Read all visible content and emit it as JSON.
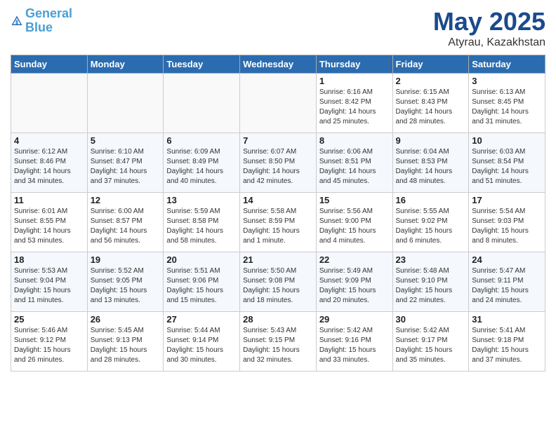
{
  "header": {
    "logo_line1": "General",
    "logo_line2": "Blue",
    "title": "May 2025",
    "location": "Atyrau, Kazakhstan"
  },
  "weekdays": [
    "Sunday",
    "Monday",
    "Tuesday",
    "Wednesday",
    "Thursday",
    "Friday",
    "Saturday"
  ],
  "weeks": [
    [
      {
        "day": "",
        "info": "",
        "empty": true
      },
      {
        "day": "",
        "info": "",
        "empty": true
      },
      {
        "day": "",
        "info": "",
        "empty": true
      },
      {
        "day": "",
        "info": "",
        "empty": true
      },
      {
        "day": "1",
        "info": "Sunrise: 6:16 AM\nSunset: 8:42 PM\nDaylight: 14 hours\nand 25 minutes."
      },
      {
        "day": "2",
        "info": "Sunrise: 6:15 AM\nSunset: 8:43 PM\nDaylight: 14 hours\nand 28 minutes."
      },
      {
        "day": "3",
        "info": "Sunrise: 6:13 AM\nSunset: 8:45 PM\nDaylight: 14 hours\nand 31 minutes."
      }
    ],
    [
      {
        "day": "4",
        "info": "Sunrise: 6:12 AM\nSunset: 8:46 PM\nDaylight: 14 hours\nand 34 minutes."
      },
      {
        "day": "5",
        "info": "Sunrise: 6:10 AM\nSunset: 8:47 PM\nDaylight: 14 hours\nand 37 minutes."
      },
      {
        "day": "6",
        "info": "Sunrise: 6:09 AM\nSunset: 8:49 PM\nDaylight: 14 hours\nand 40 minutes."
      },
      {
        "day": "7",
        "info": "Sunrise: 6:07 AM\nSunset: 8:50 PM\nDaylight: 14 hours\nand 42 minutes."
      },
      {
        "day": "8",
        "info": "Sunrise: 6:06 AM\nSunset: 8:51 PM\nDaylight: 14 hours\nand 45 minutes."
      },
      {
        "day": "9",
        "info": "Sunrise: 6:04 AM\nSunset: 8:53 PM\nDaylight: 14 hours\nand 48 minutes."
      },
      {
        "day": "10",
        "info": "Sunrise: 6:03 AM\nSunset: 8:54 PM\nDaylight: 14 hours\nand 51 minutes."
      }
    ],
    [
      {
        "day": "11",
        "info": "Sunrise: 6:01 AM\nSunset: 8:55 PM\nDaylight: 14 hours\nand 53 minutes."
      },
      {
        "day": "12",
        "info": "Sunrise: 6:00 AM\nSunset: 8:57 PM\nDaylight: 14 hours\nand 56 minutes."
      },
      {
        "day": "13",
        "info": "Sunrise: 5:59 AM\nSunset: 8:58 PM\nDaylight: 14 hours\nand 58 minutes."
      },
      {
        "day": "14",
        "info": "Sunrise: 5:58 AM\nSunset: 8:59 PM\nDaylight: 15 hours\nand 1 minute."
      },
      {
        "day": "15",
        "info": "Sunrise: 5:56 AM\nSunset: 9:00 PM\nDaylight: 15 hours\nand 4 minutes."
      },
      {
        "day": "16",
        "info": "Sunrise: 5:55 AM\nSunset: 9:02 PM\nDaylight: 15 hours\nand 6 minutes."
      },
      {
        "day": "17",
        "info": "Sunrise: 5:54 AM\nSunset: 9:03 PM\nDaylight: 15 hours\nand 8 minutes."
      }
    ],
    [
      {
        "day": "18",
        "info": "Sunrise: 5:53 AM\nSunset: 9:04 PM\nDaylight: 15 hours\nand 11 minutes."
      },
      {
        "day": "19",
        "info": "Sunrise: 5:52 AM\nSunset: 9:05 PM\nDaylight: 15 hours\nand 13 minutes."
      },
      {
        "day": "20",
        "info": "Sunrise: 5:51 AM\nSunset: 9:06 PM\nDaylight: 15 hours\nand 15 minutes."
      },
      {
        "day": "21",
        "info": "Sunrise: 5:50 AM\nSunset: 9:08 PM\nDaylight: 15 hours\nand 18 minutes."
      },
      {
        "day": "22",
        "info": "Sunrise: 5:49 AM\nSunset: 9:09 PM\nDaylight: 15 hours\nand 20 minutes."
      },
      {
        "day": "23",
        "info": "Sunrise: 5:48 AM\nSunset: 9:10 PM\nDaylight: 15 hours\nand 22 minutes."
      },
      {
        "day": "24",
        "info": "Sunrise: 5:47 AM\nSunset: 9:11 PM\nDaylight: 15 hours\nand 24 minutes."
      }
    ],
    [
      {
        "day": "25",
        "info": "Sunrise: 5:46 AM\nSunset: 9:12 PM\nDaylight: 15 hours\nand 26 minutes."
      },
      {
        "day": "26",
        "info": "Sunrise: 5:45 AM\nSunset: 9:13 PM\nDaylight: 15 hours\nand 28 minutes."
      },
      {
        "day": "27",
        "info": "Sunrise: 5:44 AM\nSunset: 9:14 PM\nDaylight: 15 hours\nand 30 minutes."
      },
      {
        "day": "28",
        "info": "Sunrise: 5:43 AM\nSunset: 9:15 PM\nDaylight: 15 hours\nand 32 minutes."
      },
      {
        "day": "29",
        "info": "Sunrise: 5:42 AM\nSunset: 9:16 PM\nDaylight: 15 hours\nand 33 minutes."
      },
      {
        "day": "30",
        "info": "Sunrise: 5:42 AM\nSunset: 9:17 PM\nDaylight: 15 hours\nand 35 minutes."
      },
      {
        "day": "31",
        "info": "Sunrise: 5:41 AM\nSunset: 9:18 PM\nDaylight: 15 hours\nand 37 minutes."
      }
    ]
  ]
}
